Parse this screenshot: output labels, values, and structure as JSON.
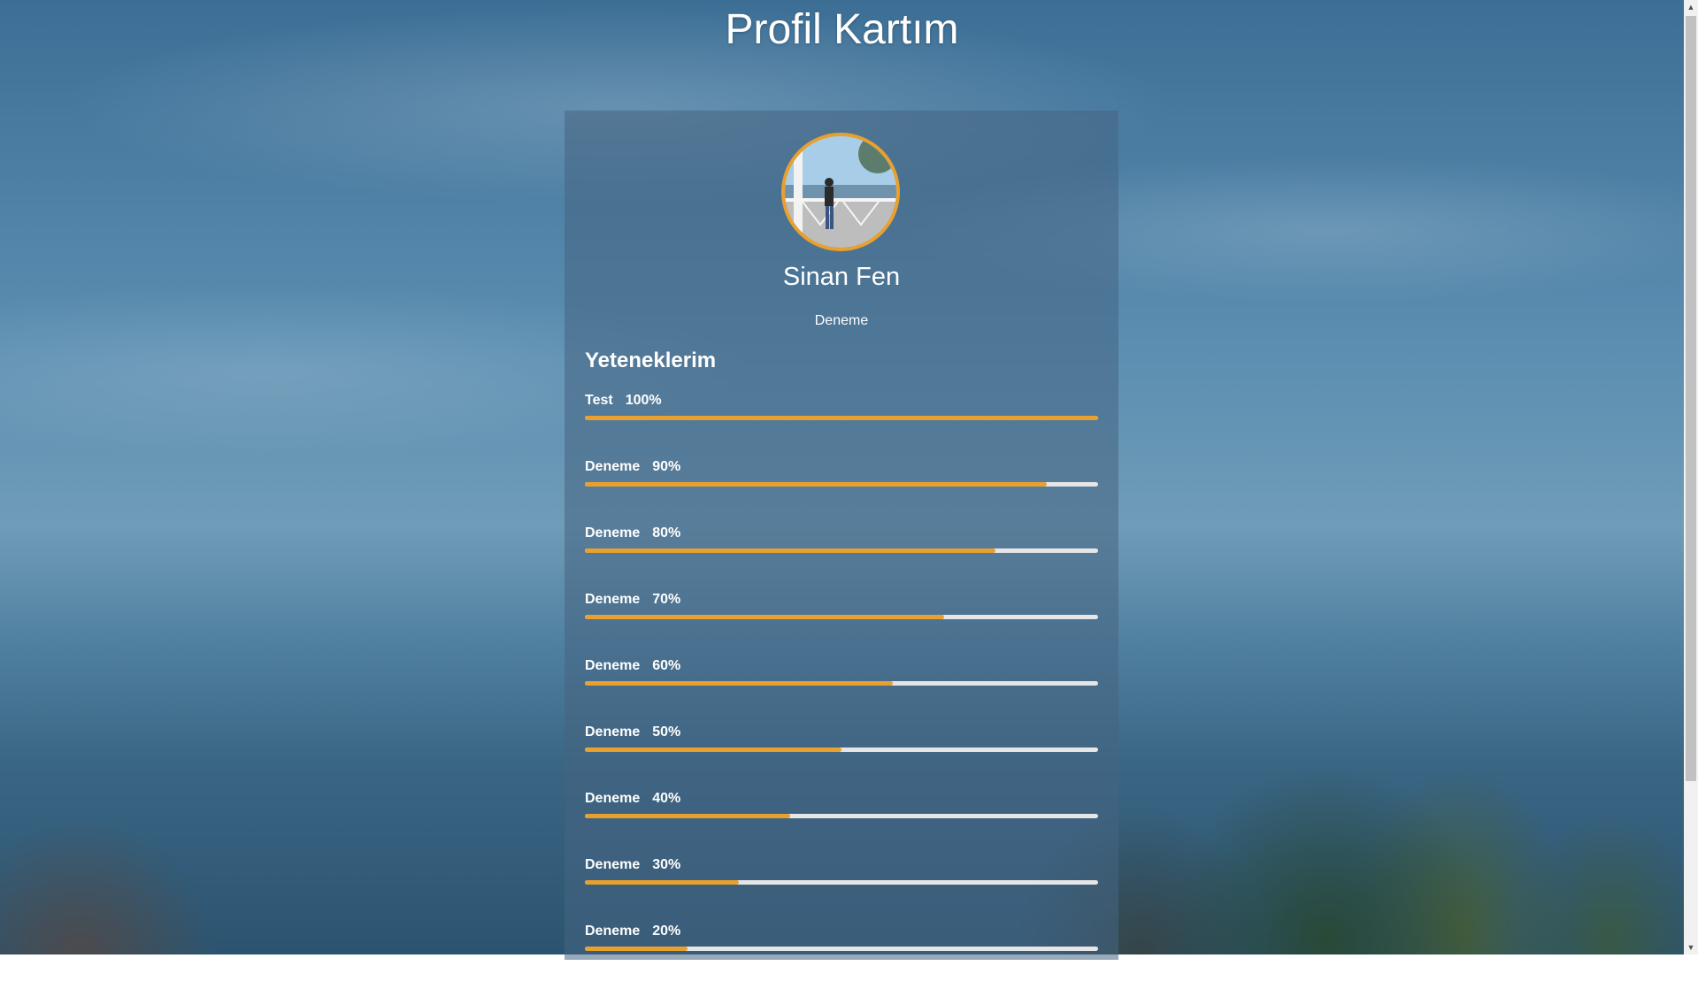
{
  "page": {
    "title": "Profil Kartım"
  },
  "profile": {
    "name": "Sinan Fen",
    "subtitle": "Deneme",
    "accent_color": "#e8a02f"
  },
  "skills": {
    "title": "Yeteneklerim",
    "items": [
      {
        "label": "Test",
        "percent_text": "100%",
        "percent": 100
      },
      {
        "label": "Deneme",
        "percent_text": "90%",
        "percent": 90
      },
      {
        "label": "Deneme",
        "percent_text": "80%",
        "percent": 80
      },
      {
        "label": "Deneme",
        "percent_text": "70%",
        "percent": 70
      },
      {
        "label": "Deneme",
        "percent_text": "60%",
        "percent": 60
      },
      {
        "label": "Deneme",
        "percent_text": "50%",
        "percent": 50
      },
      {
        "label": "Deneme",
        "percent_text": "40%",
        "percent": 40
      },
      {
        "label": "Deneme",
        "percent_text": "30%",
        "percent": 30
      },
      {
        "label": "Deneme",
        "percent_text": "20%",
        "percent": 20
      }
    ]
  },
  "icons": {
    "scroll_up": "scroll-up-arrow-icon",
    "scroll_down": "scroll-down-arrow-icon"
  }
}
